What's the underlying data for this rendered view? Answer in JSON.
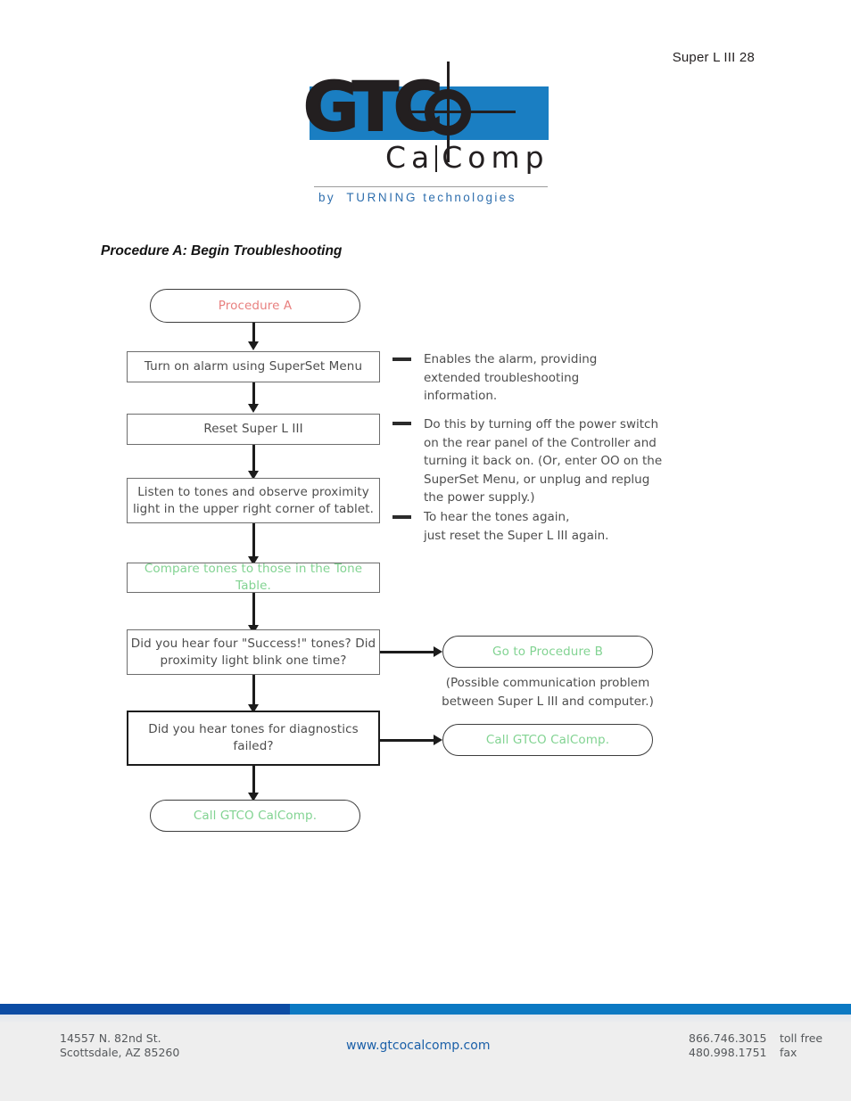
{
  "header": {
    "running_head": "Super L III 28"
  },
  "logo": {
    "wordmark_main": "GTC",
    "wordmark_sub_left": "Ca",
    "wordmark_sub_right": "Comp",
    "tagline_by": "by",
    "tagline_brand": "TURNING",
    "tagline_word": "technologies",
    "blue": "#1a7ec2",
    "tagline_color": "#2f6fae"
  },
  "section": {
    "title": "Procedure A: Begin Troubleshooting"
  },
  "flowchart": {
    "start": "Procedure A",
    "steps": [
      "Turn on alarm using SuperSet Menu",
      "Reset Super L III",
      "Listen to tones and observe proximity\nlight in the upper right corner of tablet.",
      "Compare tones to those in the Tone Table."
    ],
    "decisions": [
      "Did you hear four \"Success!\" tones?\nDid proximity light blink one time?",
      "Did you hear tones for\ndiagnostics failed?"
    ],
    "branches": [
      "Go to Procedure B",
      "Call GTCO CalComp."
    ],
    "end": "Call GTCO CalComp.",
    "note": "(Possible communication problem\nbetween Super L III and computer.)",
    "annotations": [
      "Enables the alarm, providing\nextended troubleshooting\ninformation.",
      "Do this by turning off the power switch\non the rear panel of the Controller and\nturning it back on. (Or, enter OO on the\nSuperSet Menu, or unplug and replug\nthe power supply.)",
      "To hear the tones again,\njust reset the Super L III again."
    ],
    "colors": {
      "start_text": "#e8807f",
      "terminal_text": "#82d392",
      "box_border": "#6d6d6d",
      "emphasis_border": "#1c1c1c"
    }
  },
  "footer": {
    "address": "14557 N. 82nd St.\nScottsdale, AZ 85260",
    "website": "www.gtcocalcomp.com",
    "numbers": "866.746.3015\n480.998.1751",
    "number_labels": "toll free\nfax",
    "bar_left_color": "#0b4ca4",
    "bar_right_color": "#0b79c3"
  }
}
